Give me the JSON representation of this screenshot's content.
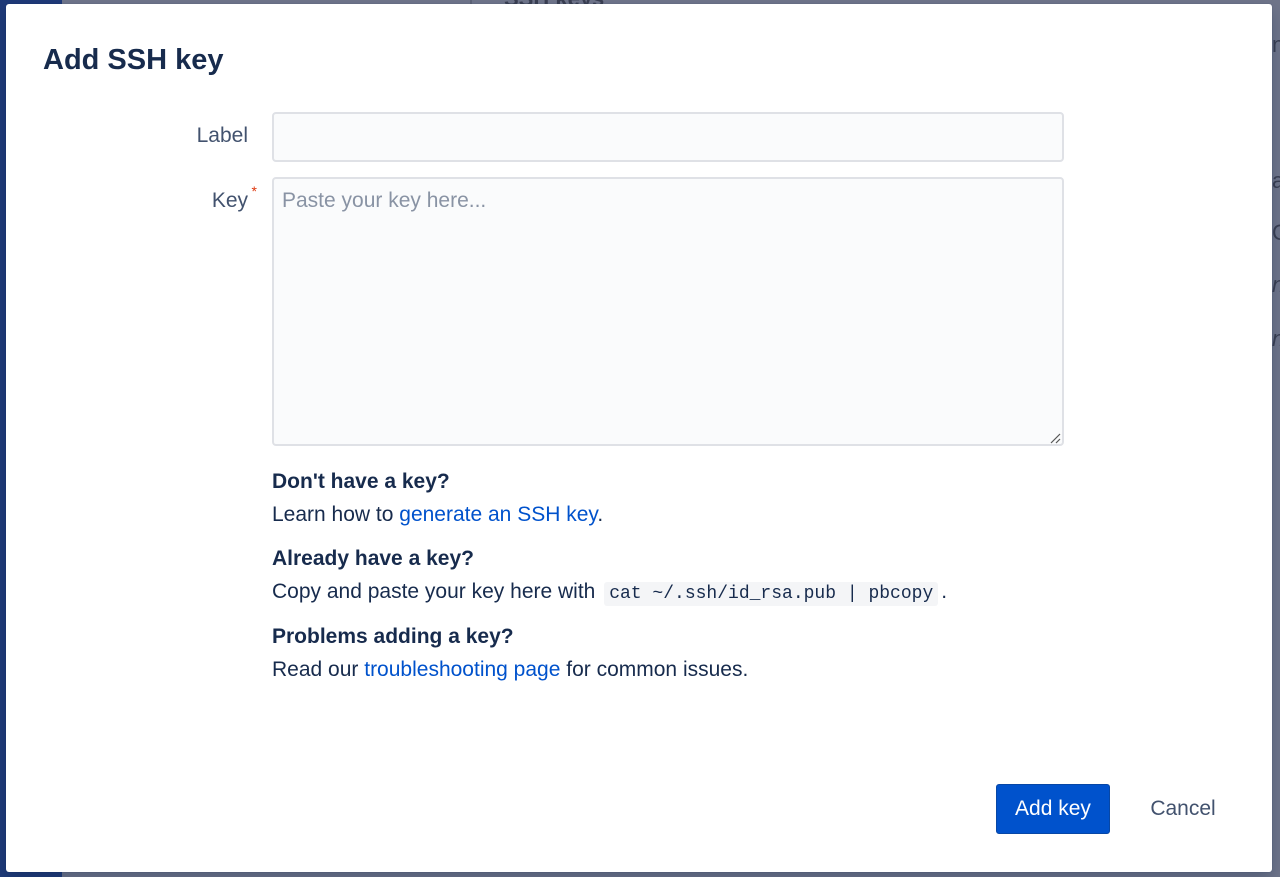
{
  "dialog": {
    "title": "Add SSH key",
    "label_field": {
      "label": "Label",
      "value": ""
    },
    "key_field": {
      "label": "Key",
      "required_marker": "*",
      "placeholder": "Paste your key here...",
      "value": ""
    },
    "help": {
      "no_key": {
        "heading": "Don't have a key?",
        "text_before": "Learn how to ",
        "link": "generate an SSH key",
        "text_after": "."
      },
      "have_key": {
        "heading": "Already have a key?",
        "text_before": "Copy and paste your key here with",
        "code": "cat ~/.ssh/id_rsa.pub | pbcopy",
        "text_after": "."
      },
      "problems": {
        "heading": "Problems adding a key?",
        "text_before": "Read our ",
        "link": "troubleshooting page",
        "text_after": " for common issues."
      }
    },
    "buttons": {
      "add": "Add key",
      "cancel": "Cancel"
    }
  },
  "colors": {
    "primary": "#0052cc",
    "link": "#0052cc",
    "required": "#de350b",
    "heading": "#172b4d"
  },
  "background_fragments": {
    "top": "SSH keys",
    "r1": "n",
    "r2": "a",
    "r3": "C",
    "r4": "n",
    "r5": "n"
  }
}
